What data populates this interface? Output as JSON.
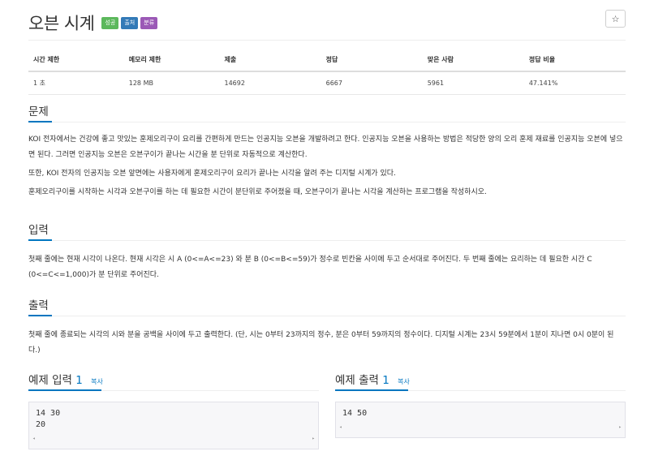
{
  "problem": {
    "title": "오븐 시계",
    "labels": [
      {
        "text": "성공",
        "color": "#5cb85c"
      },
      {
        "text": "출처",
        "color": "#337ab7"
      },
      {
        "text": "분류",
        "color": "#9b59b6"
      }
    ],
    "star": "☆"
  },
  "stats": {
    "headers": [
      "시간 제한",
      "메모리 제한",
      "제출",
      "정답",
      "맞은 사람",
      "정답 비율"
    ],
    "values": [
      "1 초",
      "128 MB",
      "14692",
      "6667",
      "5961",
      "47.141%"
    ]
  },
  "sections": {
    "problem_title": "문제",
    "problem_paragraphs": [
      "KOI 전자에서는 건강에 좋고 맛있는 훈제오리구이 요리를 간편하게 만드는 인공지능 오븐을 개발하려고 한다. 인공지능 오븐을 사용하는 방법은 적당한 양의 오리 훈제 재료를 인공지능 오븐에 넣으면 된다. 그러면 인공지능 오븐은 오븐구이가 끝나는 시간을 분 단위로 자동적으로 계산한다.",
      "또한, KOI 전자의 인공지능 오븐 앞면에는 사용자에게 훈제오리구이 요리가 끝나는 시각을 알려 주는 디지털 시계가 있다.",
      "훈제오리구이를 시작하는 시각과 오븐구이를 하는 데 필요한 시간이 분단위로 주어졌을 때, 오븐구이가 끝나는 시각을 계산하는 프로그램을 작성하시오."
    ],
    "input_title": "입력",
    "input_paragraph": "첫째 줄에는 현재 시각이 나온다. 현재 시각은 시 A (0<=A<=23) 와 분 B (0<=B<=59)가 정수로 빈칸을 사이에 두고 순서대로 주어진다. 두 번째 줄에는 요리하는 데 필요한 시간 C (0<=C<=1,000)가 분 단위로 주어진다.",
    "output_title": "출력",
    "output_paragraph": "첫째 줄에 종료되는 시각의 시와 분을 공백을 사이에 두고 출력한다. (단, 시는 0부터 23까지의 정수, 분은 0부터 59까지의 정수이다. 디지털 시계는 23시 59분에서 1분이 지나면 0시 0분이 된다.)"
  },
  "samples": {
    "input": {
      "title": "예제 입력",
      "number": "1",
      "copy": "복사",
      "content": "14 30\n20"
    },
    "output": {
      "title": "예제 출력",
      "number": "1",
      "copy": "복사",
      "content": "14 50"
    },
    "scroll_left": "◂",
    "scroll_right": "▸"
  },
  "colors": {
    "accent": "#0076c0"
  }
}
